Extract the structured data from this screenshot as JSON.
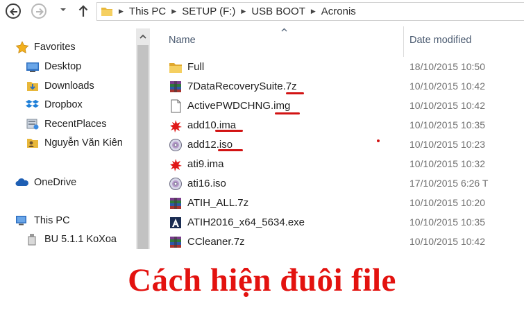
{
  "address_bar": {
    "breadcrumbs": [
      "This PC",
      "SETUP (F:)",
      "USB BOOT",
      "Acronis"
    ]
  },
  "navigation": {
    "favorites_label": "Favorites",
    "favorites": [
      "Desktop",
      "Downloads",
      "Dropbox",
      "RecentPlaces",
      "Nguyễn Văn Kiên"
    ],
    "onedrive_label": "OneDrive",
    "thispc_label": "This PC",
    "thispc_children": [
      "BU 5.1.1 KoXoa"
    ]
  },
  "file_list": {
    "columns": [
      "Name",
      "Date modified"
    ],
    "rows": [
      {
        "name": "Full",
        "date": "18/10/2015 10:50",
        "icon": "folder-icon"
      },
      {
        "name": "7DataRecoverySuite.7z",
        "date": "10/10/2015 10:42",
        "icon": "archive-icon"
      },
      {
        "name": "ActivePWDCHNG.img",
        "date": "10/10/2015 10:42",
        "icon": "disk-image-icon"
      },
      {
        "name": "add10.ima",
        "date": "10/10/2015 10:35",
        "icon": "floppy-image-icon"
      },
      {
        "name": "add12.iso",
        "date": "10/10/2015 10:23",
        "icon": "iso-disc-icon"
      },
      {
        "name": "ati9.ima",
        "date": "10/10/2015 10:32",
        "icon": "floppy-image-icon"
      },
      {
        "name": "ati16.iso",
        "date": "17/10/2015 6:26 T",
        "icon": "iso-disc-icon"
      },
      {
        "name": "ATIH_ALL.7z",
        "date": "10/10/2015 10:20",
        "icon": "archive-icon"
      },
      {
        "name": "ATIH2016_x64_5634.exe",
        "date": "10/10/2015 10:35",
        "icon": "acronis-exe-icon"
      },
      {
        "name": "CCleaner.7z",
        "date": "10/10/2015 10:42",
        "icon": "archive-icon"
      }
    ]
  },
  "caption": "Cách hiện đuôi file",
  "colors": {
    "annotation_red": "#d21313",
    "caption_red": "#e3120f",
    "folder_yellow": "#e8b73a"
  }
}
